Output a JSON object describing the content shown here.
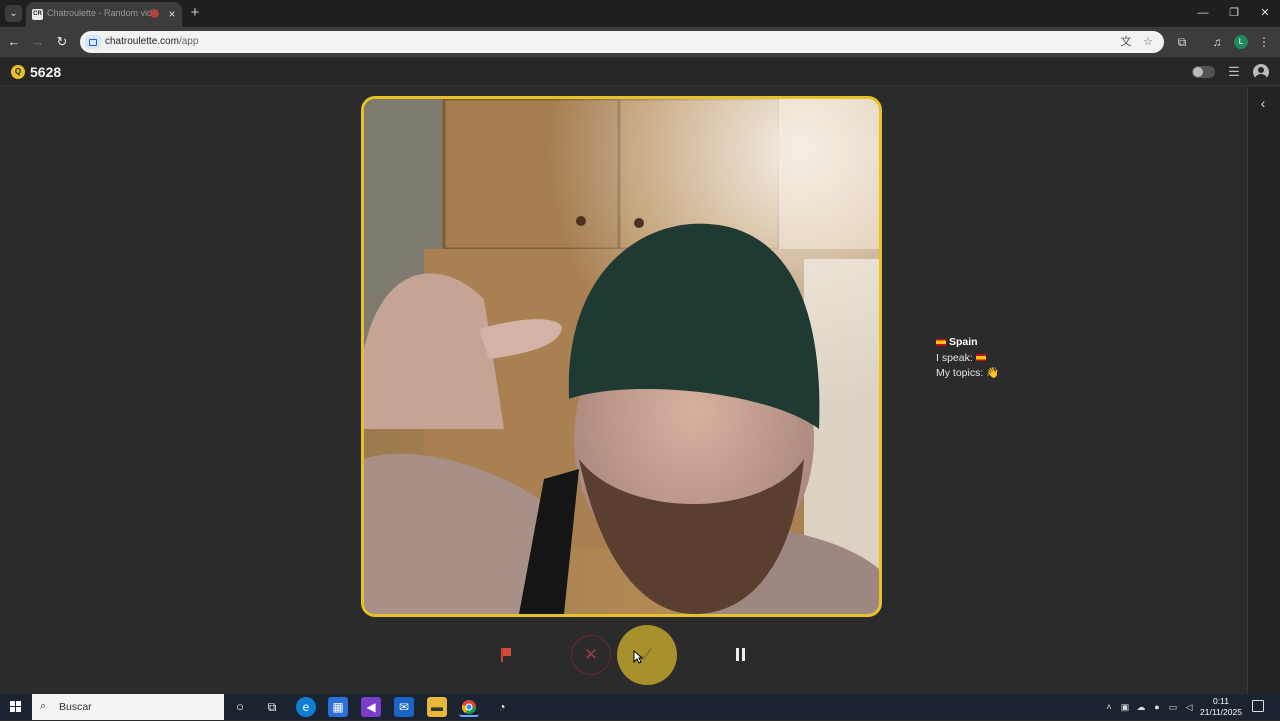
{
  "browser": {
    "tab_title": "Chatroulette - Random vid",
    "tab_favicon_text": "CR",
    "url_host": "chatroulette.com",
    "url_path": "/app",
    "profile_initial": "L",
    "icons": {
      "tab_menu": "chevron-down-icon",
      "close": "close-icon",
      "new_tab": "plus-icon",
      "back": "arrow-left-icon",
      "forward": "arrow-right-icon",
      "reload": "reload-icon",
      "translate": "translate-icon",
      "bookmark": "star-icon",
      "extensions": "puzzle-icon",
      "media": "media-control-icon",
      "menu": "kebab-menu-icon"
    }
  },
  "app": {
    "coins": "5628",
    "coin_glyph": "Q",
    "accent_color": "#e6c229",
    "partner": {
      "country": "Spain",
      "speak_label": "I speak:",
      "topics_label": "My topics:",
      "topics_emoji": "👋"
    },
    "controls": {
      "skip_glyph": "✕",
      "accept_glyph": "✓"
    }
  },
  "taskbar": {
    "search_placeholder": "Buscar",
    "time": "0:11",
    "date": "21/11/2025"
  }
}
